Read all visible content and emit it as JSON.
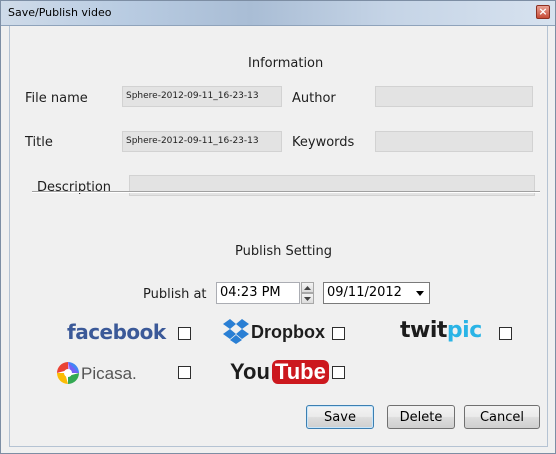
{
  "window": {
    "title": "Save/Publish video",
    "close_glyph": "×"
  },
  "information": {
    "heading": "Information",
    "file_name_label": "File name",
    "file_name_value": "Sphere-2012-09-11_16-23-13",
    "author_label": "Author",
    "author_value": "",
    "title_label": "Title",
    "title_value": "Sphere-2012-09-11_16-23-13",
    "keywords_label": "Keywords",
    "keywords_value": "",
    "description_label": "Description",
    "description_value": ""
  },
  "publish": {
    "heading": "Publish Setting",
    "publish_at_label": "Publish at",
    "time_value": "04:23 PM",
    "date_value": "09/11/2012",
    "services": [
      {
        "name": "facebook",
        "checked": false
      },
      {
        "name": "Dropbox",
        "checked": false
      },
      {
        "name": "twitpic",
        "checked": false
      },
      {
        "name": "Picasa",
        "checked": false
      },
      {
        "name": "YouTube",
        "checked": false
      }
    ]
  },
  "logos": {
    "facebook_text": "facebook",
    "dropbox_text": "Dropbox",
    "twitpic_text_a": "twit",
    "twitpic_text_b": "pic",
    "picasa_text": "Picasa.",
    "youtube_text_a": "You",
    "youtube_text_b": "Tube"
  },
  "buttons": {
    "save": "Save",
    "delete": "Delete",
    "cancel": "Cancel"
  },
  "colors": {
    "facebook": "#3b5998",
    "dropbox": "#2a7fd4",
    "twitpic_dark": "#1c1c1c",
    "twitpic_accent": "#2ab4e6",
    "youtube_red": "#cc181e",
    "close_red": "#c74b36"
  }
}
